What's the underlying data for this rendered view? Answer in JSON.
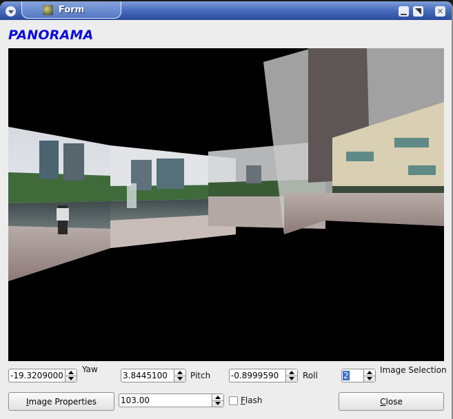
{
  "window": {
    "title": "Form",
    "heading": "PANORAMA",
    "title_bar_buttons": [
      "menu",
      "minimize",
      "maximize",
      "close"
    ]
  },
  "viewer": {
    "content": "stitched panorama preview of city park with fountain and high-rise buildings",
    "background": "#000000"
  },
  "controls": {
    "yaw": {
      "value": "-19.3209000",
      "label": "Yaw"
    },
    "pitch": {
      "value": "3.8445100",
      "label": "Pitch"
    },
    "roll": {
      "value": "-0.8999590",
      "label": "Roll"
    },
    "image_selection": {
      "value": "2",
      "label": "Image Selection"
    },
    "image_properties_button": {
      "prefix": "",
      "mnemonic": "I",
      "rest": "mage Properties"
    },
    "fov": {
      "value": "103.00"
    },
    "flash": {
      "mnemonic": "F",
      "rest": "lash",
      "checked": false
    },
    "close_button": {
      "mnemonic": "C",
      "rest": "lose"
    }
  },
  "colors": {
    "heading": "#0a0ae0",
    "titlebar": "#3a5eb0",
    "selection": "#3a6ccc"
  }
}
